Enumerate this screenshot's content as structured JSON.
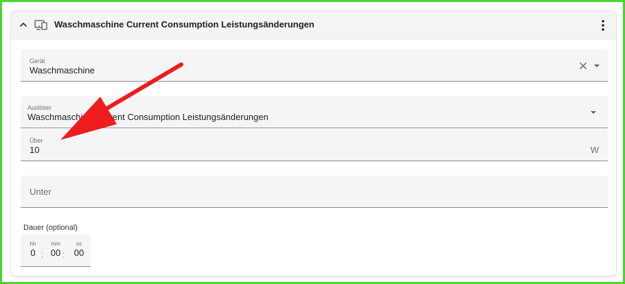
{
  "header": {
    "title": "Waschmaschine Current Consumption Leistungsänderungen"
  },
  "device_field": {
    "label": "Gerät",
    "value": "Waschmaschine"
  },
  "trigger_field": {
    "label": "Auslöser",
    "value": "Waschmaschine Current Consumption Leistungsänderungen"
  },
  "above_field": {
    "label": "Über",
    "value": "10",
    "unit": "W"
  },
  "below_field": {
    "placeholder": "Unter"
  },
  "duration": {
    "label": "Dauer (optional)",
    "hours_label": "hh",
    "minutes_label": "mm",
    "seconds_label": "ss",
    "hours": "0",
    "minutes": "00",
    "seconds": "00",
    "separator": ":"
  },
  "colors": {
    "frame_border": "#4ad42f",
    "annotation_arrow": "#ee1c1c"
  }
}
